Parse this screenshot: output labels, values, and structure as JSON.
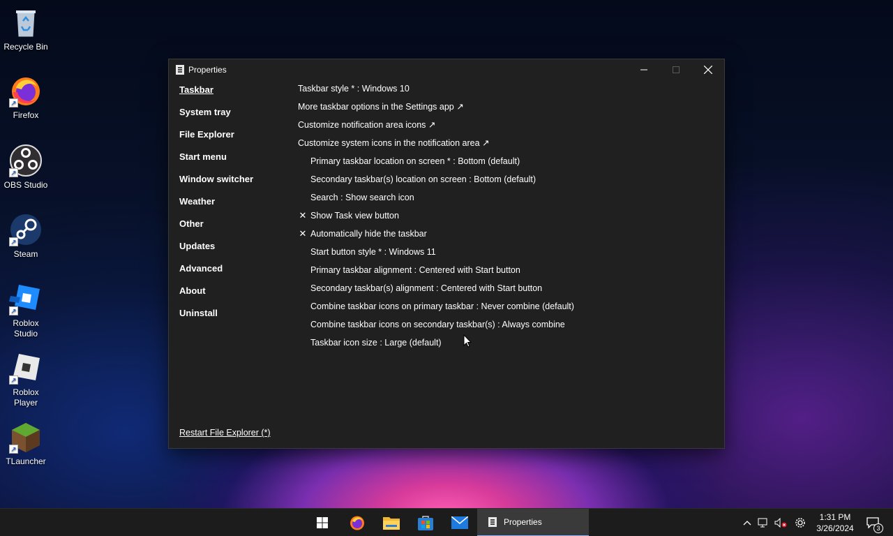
{
  "desktop": {
    "icons": [
      {
        "label": "Recycle Bin"
      },
      {
        "label": "Firefox"
      },
      {
        "label": "OBS Studio"
      },
      {
        "label": "Steam"
      },
      {
        "label": "Roblox Studio"
      },
      {
        "label": "Roblox Player"
      },
      {
        "label": "TLauncher"
      }
    ]
  },
  "window": {
    "title": "Properties",
    "controls": {
      "minimize": "minimize-icon",
      "maximize": "maximize-icon",
      "close": "close-icon"
    }
  },
  "sidebar": {
    "items": [
      {
        "label": "Taskbar",
        "active": true
      },
      {
        "label": "System tray"
      },
      {
        "label": "File Explorer"
      },
      {
        "label": "Start menu"
      },
      {
        "label": "Window switcher"
      },
      {
        "label": "Weather"
      },
      {
        "label": "Other"
      },
      {
        "label": "Updates"
      },
      {
        "label": "Advanced"
      },
      {
        "label": "About"
      },
      {
        "label": "Uninstall"
      }
    ],
    "restart_label": "Restart File Explorer (*)"
  },
  "settings": [
    {
      "label": "Taskbar style * : Windows 10"
    },
    {
      "label": "More taskbar options in the Settings app ↗"
    },
    {
      "label": "Customize notification area icons ↗"
    },
    {
      "label": "Customize system icons in the notification area ↗"
    },
    {
      "label": "Primary taskbar location on screen * : Bottom (default)"
    },
    {
      "label": "Secondary taskbar(s) location on screen : Bottom (default)"
    },
    {
      "label": "Search : Show search icon"
    },
    {
      "label": "Show Task view button",
      "check": "✕"
    },
    {
      "label": "Automatically hide the taskbar",
      "check": "✕"
    },
    {
      "label": "Start button style * : Windows 11"
    },
    {
      "label": "Primary taskbar alignment : Centered with Start button"
    },
    {
      "label": "Secondary taskbar(s) alignment : Centered with Start button"
    },
    {
      "label": "Combine taskbar icons on primary taskbar : Never combine (default)"
    },
    {
      "label": "Combine taskbar icons on secondary taskbar(s) : Always combine"
    },
    {
      "label": "Taskbar icon size : Large (default)"
    }
  ],
  "taskbar": {
    "pinned": [
      "start-icon",
      "firefox-icon",
      "file-explorer-icon",
      "store-icon",
      "mail-icon"
    ],
    "active_app": "Properties",
    "clock": {
      "time": "1:31 PM",
      "date": "3/26/2024"
    },
    "notification_count": "3",
    "colors": {
      "accent": "#8ab4ff",
      "background": "#1c1c1c"
    }
  }
}
